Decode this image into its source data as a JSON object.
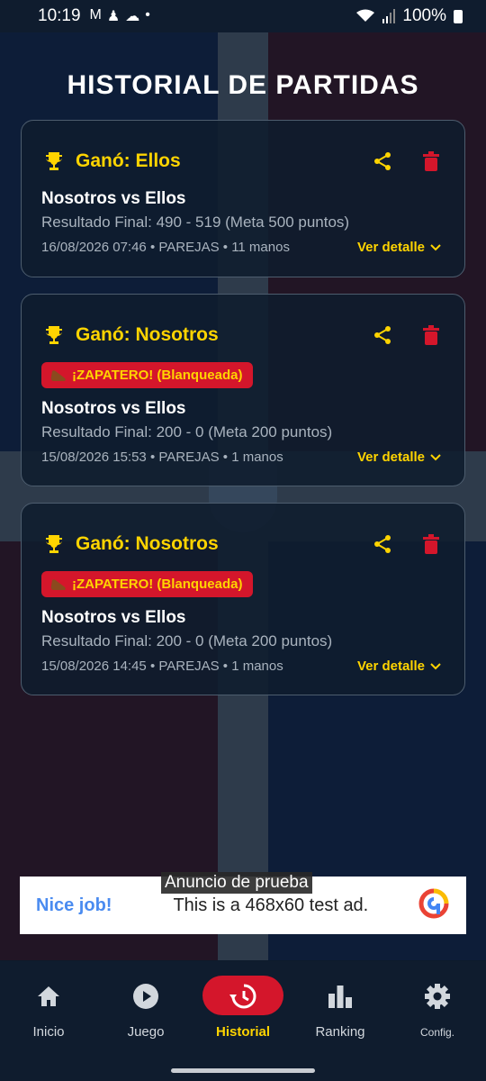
{
  "status_bar": {
    "time": "10:19",
    "battery": "100%"
  },
  "page": {
    "title": "HISTORIAL DE PARTIDAS"
  },
  "colors": {
    "accent_yellow": "#ffd400",
    "accent_red": "#d4162b",
    "background": "#0d1a2b"
  },
  "matches": [
    {
      "winner": "Ganó: Ellos",
      "badge": "",
      "teams": "Nosotros vs Ellos",
      "result": "Resultado Final: 490 - 519 (Meta 500 puntos)",
      "meta": "16/08/2026 07:46 • PAREJAS • 11 manos",
      "detail_label": "Ver detalle"
    },
    {
      "winner": "Ganó: Nosotros",
      "badge": "¡ZAPATERO! (Blanqueada)",
      "teams": "Nosotros vs Ellos",
      "result": "Resultado Final: 200 - 0 (Meta 200 puntos)",
      "meta": "15/08/2026 15:53 • PAREJAS • 1 manos",
      "detail_label": "Ver detalle"
    },
    {
      "winner": "Ganó: Nosotros",
      "badge": "¡ZAPATERO! (Blanqueada)",
      "teams": "Nosotros vs Ellos",
      "result": "Resultado Final: 200 - 0 (Meta 200 puntos)",
      "meta": "15/08/2026 14:45 • PAREJAS • 1 manos",
      "detail_label": "Ver detalle"
    }
  ],
  "ad": {
    "label": "Anuncio de prueba",
    "headline": "Nice job!",
    "text": "This is a 468x60 test ad."
  },
  "nav": {
    "items": [
      {
        "label": "Inicio",
        "icon": "home-icon"
      },
      {
        "label": "Juego",
        "icon": "play-icon"
      },
      {
        "label": "Historial",
        "icon": "history-icon",
        "active": true
      },
      {
        "label": "Ranking",
        "icon": "bar-chart-icon"
      },
      {
        "label": "Config.",
        "icon": "gear-icon"
      }
    ]
  }
}
